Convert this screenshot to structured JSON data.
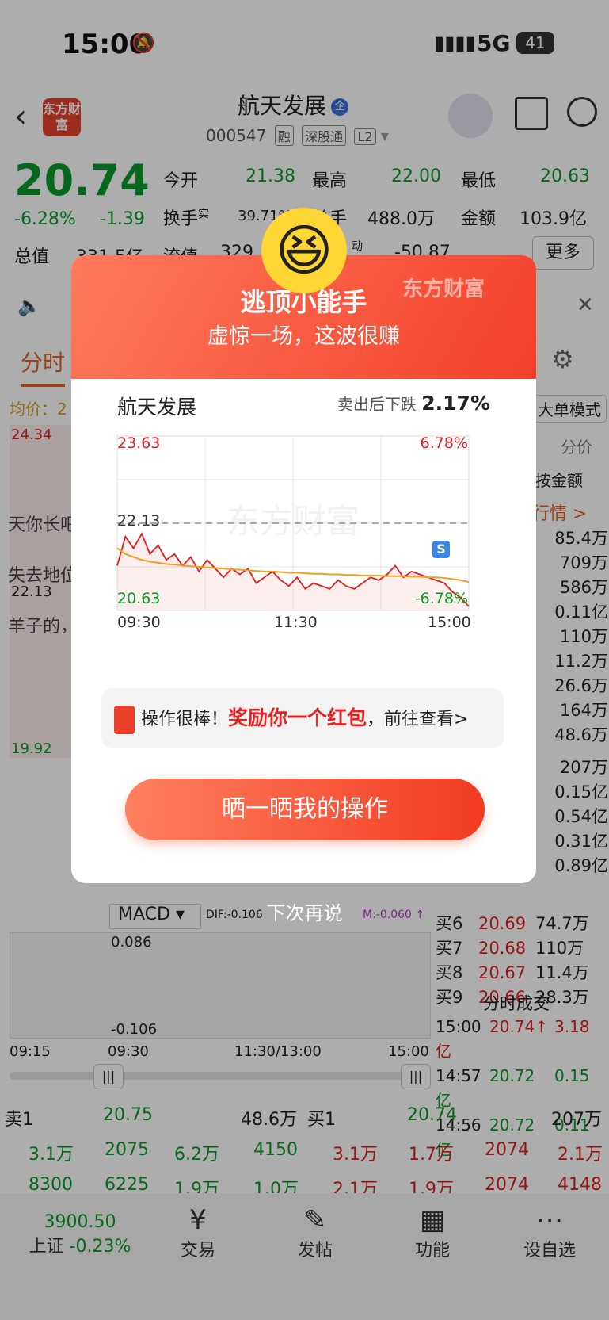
{
  "status_bar": {
    "time": "15:00",
    "network": "5G",
    "battery": "41"
  },
  "header": {
    "title": "航天发展",
    "title_badge": "企",
    "code": "000547",
    "tags": [
      "融",
      "深股通",
      "L2"
    ],
    "logo_text": "东方财富"
  },
  "quote": {
    "price": "20.74",
    "change_pct": "-6.28%",
    "change": "-1.39",
    "open_label": "今开",
    "open": "21.38",
    "high_label": "最高",
    "high": "22.00",
    "low_label": "最低",
    "low": "20.63",
    "turnover_label": "换手",
    "turnover_sup": "实",
    "turnover": "39.71%",
    "volume_label": "总手",
    "volume": "488.0万",
    "amount_label": "金额",
    "amount": "103.9亿",
    "mktcap_label": "总值",
    "mktcap": "331.5亿",
    "float_label": "流值",
    "float": "329",
    "dynamic_label": "动",
    "dynamic": "-50.87",
    "more": "更多"
  },
  "background": {
    "tab_active": "分时",
    "avg_label": "均价：2",
    "chart_high": "24.34",
    "chart_low": "19.92",
    "chart_mid": "22.13",
    "bubble1": "天你长吧",
    "bubble2": "失去地位",
    "bubble3": "羊子的，",
    "right_labels": [
      "大单模式",
      "分价",
      "按金额",
      "行情 >"
    ],
    "right_values": [
      "85.4万",
      "709万",
      "586万",
      "0.11亿",
      "110万",
      "11.2万",
      "26.6万",
      "164万",
      "48.6万",
      "207万",
      "0.15亿",
      "0.54亿",
      "0.31亿",
      "0.89亿"
    ],
    "buy_levels": [
      {
        "label": "买6",
        "price": "20.69",
        "vol": "74.7万"
      },
      {
        "label": "买7",
        "price": "20.68",
        "vol": "110万"
      },
      {
        "label": "买8",
        "price": "20.67",
        "vol": "11.4万"
      },
      {
        "label": "买9",
        "price": "20.66",
        "vol": "28.3万"
      }
    ],
    "trades_title": "分时成交",
    "trades": [
      {
        "time": "15:00",
        "price": "20.74↑",
        "vol": "3.18亿"
      },
      {
        "time": "14:57",
        "price": "20.72",
        "vol": "0.15亿"
      },
      {
        "time": "14:56",
        "price": "20.72",
        "vol": "0.11亿"
      }
    ],
    "macd_label": "MACD",
    "dif": "DIF:-0.106",
    "macd_m": "M:-0.060 ↑",
    "macd_high": "0.086",
    "macd_low": "-0.106",
    "x_ticks": [
      "09:15",
      "09:30",
      "11:30/13:00",
      "15:00"
    ],
    "sell1": {
      "label": "卖1",
      "price": "20.75",
      "vol": "48.6万"
    },
    "buy1": {
      "label": "买1",
      "price": "20.74",
      "vol": "207万"
    },
    "row_a": [
      "3.1万",
      "2075",
      "6.2万",
      "4150",
      "3.1万",
      "1.7万",
      "2074",
      "2.1万"
    ],
    "row_b": [
      "8300",
      "6225",
      "1.9万",
      "1.0万",
      "2.1万",
      "1.9万",
      "2074",
      "4148"
    ]
  },
  "modal": {
    "watermark": "东方财富",
    "title": "逃顶小能手",
    "subtitle": "虚惊一场，这波很赚",
    "stock_name": "航天发展",
    "drop_label": "卖出后下跌",
    "drop_value": "2.17%",
    "chart_watermark": "东方财富",
    "reward_pre": "操作很棒！",
    "reward_highlight": "奖励你一个红包",
    "reward_post": "，前往查看>",
    "share_button": "晒一晒我的操作",
    "dismiss": "下次再说",
    "sell_marker": "S"
  },
  "chart_data": {
    "type": "line",
    "title": "",
    "y_labels": {
      "top": "23.63",
      "mid": "22.13",
      "bottom": "20.63",
      "top_pct": "6.78%",
      "bottom_pct": "-6.78%"
    },
    "x_ticks": [
      "09:30",
      "11:30",
      "15:00"
    ],
    "ylim": [
      20.63,
      23.63
    ],
    "prev_close": 22.13,
    "series": [
      {
        "values": [
          21.4,
          21.9,
          21.7,
          21.95,
          21.6,
          21.75,
          21.5,
          21.6,
          21.4,
          21.55,
          21.3,
          21.5,
          21.35,
          21.2,
          21.35,
          21.25,
          21.35,
          21.1,
          21.2,
          21.3,
          21.15,
          21.05,
          21.2,
          21.0,
          21.1,
          21.05,
          21.0,
          21.15,
          21.05,
          21.0,
          21.1,
          21.2,
          21.15,
          21.25,
          21.4,
          21.2,
          21.3,
          21.25,
          21.2,
          21.15,
          21.1,
          20.95,
          20.85,
          20.7
        ]
      },
      {
        "values": [
          21.7,
          21.6,
          21.55,
          21.5,
          21.47,
          21.45,
          21.43,
          21.42,
          21.4,
          21.39,
          21.38,
          21.37,
          21.36,
          21.35,
          21.34,
          21.33,
          21.32,
          21.31,
          21.3,
          21.3,
          21.29,
          21.28,
          21.28,
          21.27,
          21.26,
          21.26,
          21.25,
          21.25,
          21.24,
          21.24,
          21.23,
          21.23,
          21.23,
          21.22,
          21.22,
          21.22,
          21.21,
          21.21,
          21.2,
          21.2,
          21.19,
          21.17,
          21.15,
          21.12
        ]
      }
    ],
    "grid": true
  }
}
